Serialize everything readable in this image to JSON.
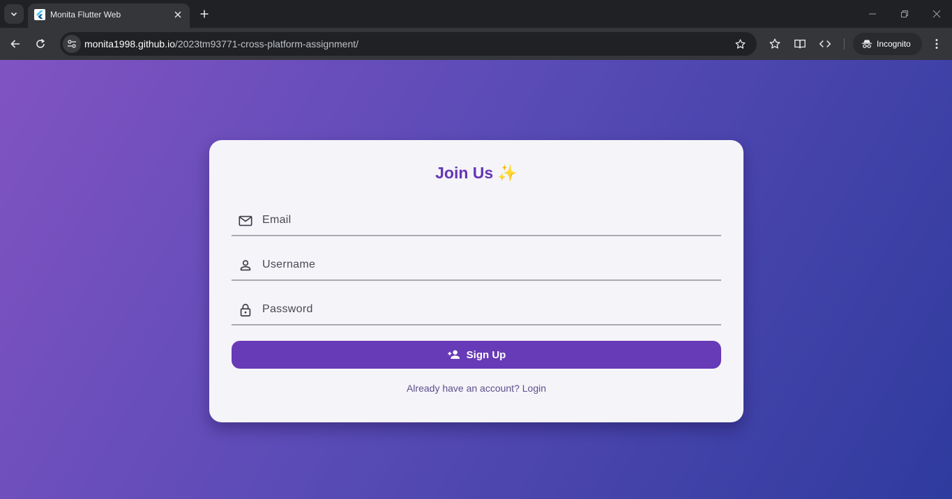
{
  "browser": {
    "tab_title": "Monita Flutter Web",
    "url_host": "monita1998.github.io",
    "url_path": "/2023tm93771-cross-platform-assignment/",
    "incognito_label": "Incognito"
  },
  "page": {
    "title": "Join Us",
    "title_emoji": "✨",
    "fields": {
      "email": {
        "placeholder": "Email",
        "value": ""
      },
      "username": {
        "placeholder": "Username",
        "value": ""
      },
      "password": {
        "placeholder": "Password",
        "value": ""
      }
    },
    "signup_button": "Sign Up",
    "login_link": "Already have an account? Login"
  },
  "colors": {
    "accent": "#673ab7",
    "title": "#6436b5",
    "gradient_start": "#8153c2",
    "gradient_end": "#2f3b9e"
  },
  "icons": {
    "email_field": "mail-icon",
    "username_field": "person-icon",
    "password_field": "lock-icon",
    "signup_button": "person-add-icon"
  }
}
